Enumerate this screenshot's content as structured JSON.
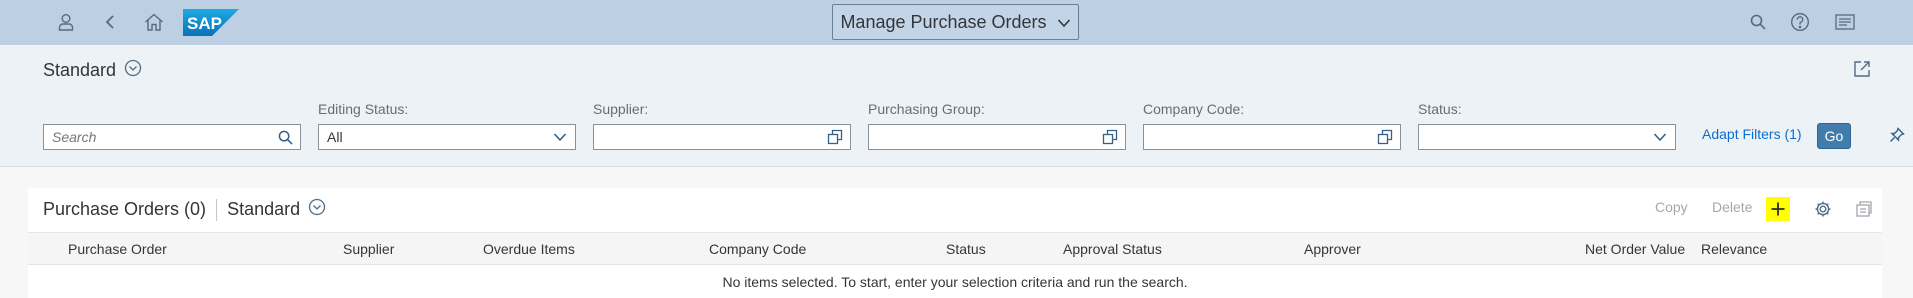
{
  "shell": {
    "app_title": "Manage Purchase Orders",
    "logo_text": "SAP",
    "icons": [
      "user-icon",
      "back-icon",
      "home-icon",
      "search-icon",
      "help-icon",
      "notifications-icon"
    ]
  },
  "header": {
    "variant": "Standard"
  },
  "filters": {
    "search_placeholder": "Search",
    "editing_status_label": "Editing Status:",
    "editing_status_value": "All",
    "supplier_label": "Supplier:",
    "supplier_value": "",
    "purchasing_group_label": "Purchasing Group:",
    "purchasing_group_value": "",
    "company_code_label": "Company Code:",
    "company_code_value": "",
    "status_label": "Status:",
    "status_value": "",
    "adapt_filters": "Adapt Filters (1)",
    "go": "Go"
  },
  "table": {
    "title": "Purchase Orders (0)",
    "variant": "Standard",
    "copy": "Copy",
    "delete": "Delete",
    "columns": [
      "Purchase Order",
      "Supplier",
      "Overdue Items",
      "Company Code",
      "Status",
      "Approval Status",
      "Approver",
      "Net Order Value",
      "Relevance"
    ],
    "no_items": "No items selected. To start, enter your selection criteria and run the search."
  },
  "colors": {
    "shell_bg": "#bccfe3",
    "header_bg": "#edf2f7",
    "accent": "#0a6ed1",
    "go_button": "#427cac",
    "highlight": "#ffff00"
  }
}
